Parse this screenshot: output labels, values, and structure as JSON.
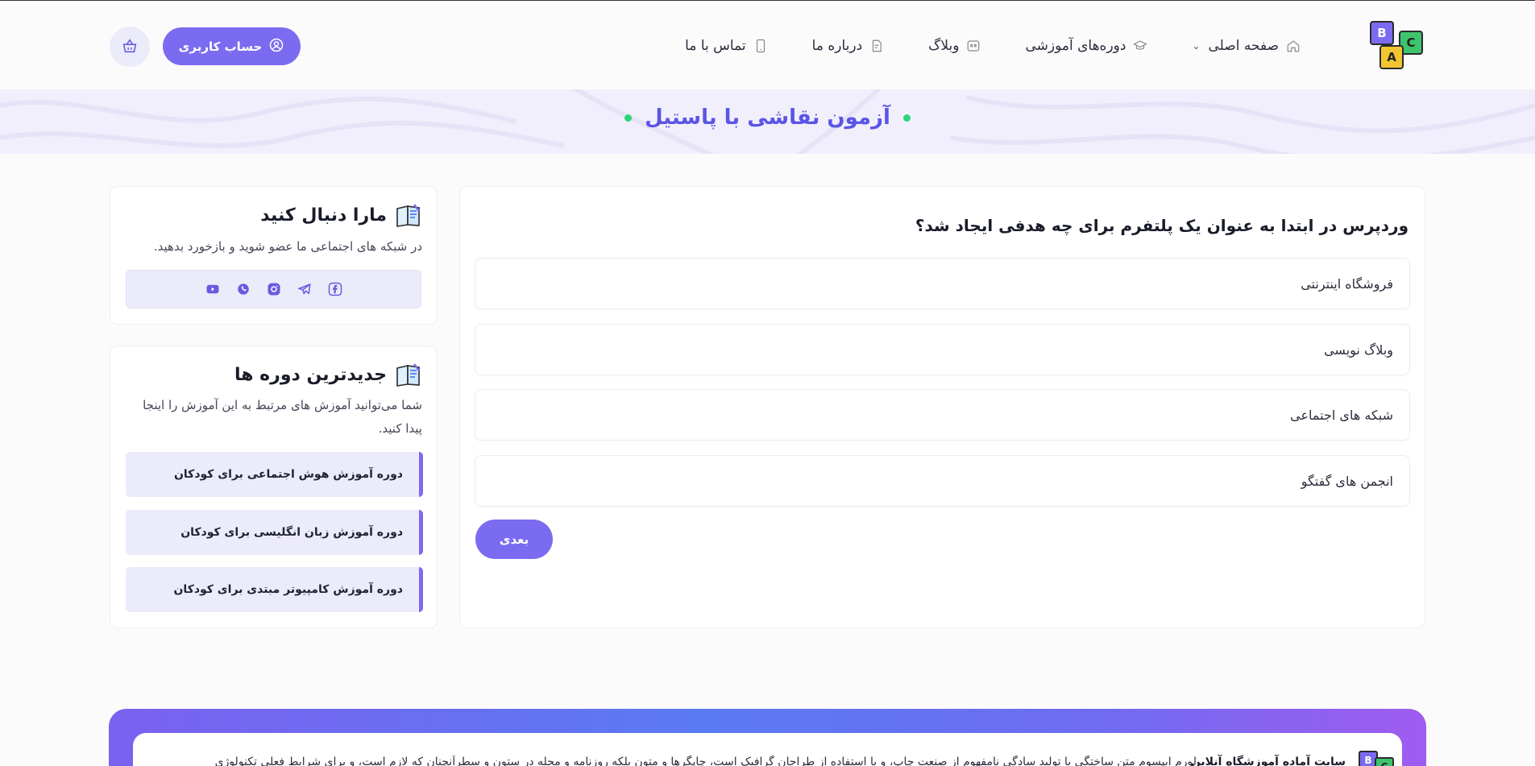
{
  "header": {
    "logo_letters": [
      "B",
      "C",
      "A"
    ],
    "nav": [
      {
        "label": "صفحه اصلی",
        "icon": "home-icon",
        "has_dropdown": true
      },
      {
        "label": "دوره‌های آموزشی",
        "icon": "graduation-cap-icon"
      },
      {
        "label": "وبلاگ",
        "icon": "quote-icon"
      },
      {
        "label": "درباره ما",
        "icon": "document-icon"
      },
      {
        "label": "تماس با ما",
        "icon": "phone-icon"
      }
    ],
    "account_label": "حساب کاربری",
    "cart_icon": "basket-icon"
  },
  "banner": {
    "title": "آزمون نقاشی با پاستیل"
  },
  "quiz": {
    "question": "وردپرس در ابتدا به عنوان یک پلتفرم برای چه هدفی ایجاد شد؟",
    "options": [
      "فروشگاه اینترنتی",
      "وبلاگ نویسی",
      "شبکه های اجتماعی",
      "انجمن های گفتگو"
    ],
    "next_label": "بعدی"
  },
  "follow": {
    "title": "مارا دنبال کنید",
    "description": "در شبکه های اجتماعی ما عضو شوید و بازخورد بدهید.",
    "socials": [
      "facebook-icon",
      "telegram-icon",
      "instagram-icon",
      "whatsapp-icon",
      "youtube-icon"
    ]
  },
  "latest_courses": {
    "title": "جدیدترین دوره ها",
    "description": "شما می‌توانید آموزش های مرتبط به این آموزش را اینجا پیدا کنید.",
    "items": [
      "دوره آموزش هوش اجتماعی برای کودکان",
      "دوره آموزش زبان انگلیسی برای کودکان",
      "دوره آموزش کامپیوتر مبتدی برای کودکان"
    ]
  },
  "footer": {
    "site_name": "سایت آماده آموزشگاه آنلاین",
    "text": "لورم ایپسوم متن ساختگی با تولید سادگی نامفهوم از صنعت چاپ، و با استفاده از طراحان گرافیک است، چاپگرها و متون بلکه روزنامه و مجله در ستون و سطرآنچنان که لازم است، و برای شرایط فعلی تکنولوژی"
  },
  "colors": {
    "primary": "#7b6bf0",
    "banner_title": "#5b55e6",
    "dot": "#2ed47a",
    "light_bg": "#ecebfa"
  }
}
